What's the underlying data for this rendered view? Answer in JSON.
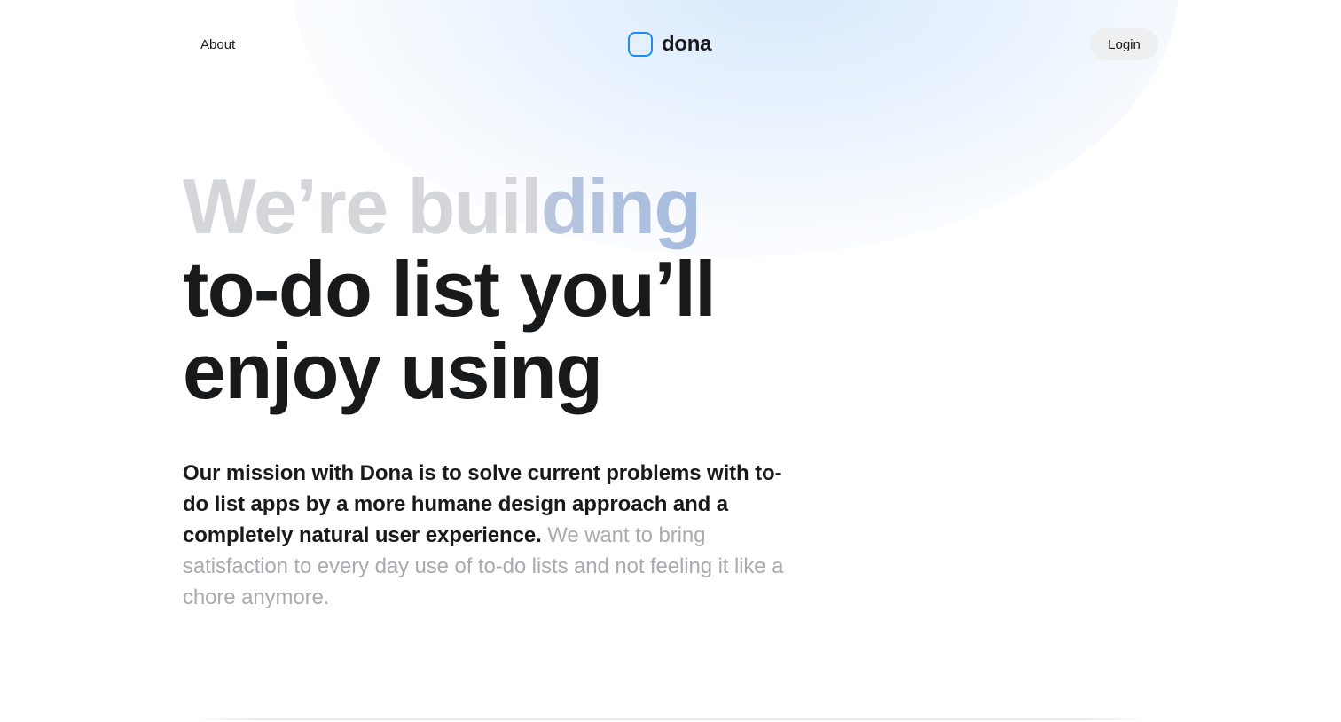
{
  "nav": {
    "about_label": "About",
    "brand_name": "dona",
    "brand_icon": "rounded-square-icon",
    "login_label": "Login"
  },
  "hero": {
    "line1_muted": "We’re buil",
    "line1_accent": "ding",
    "line2": "to-do list you’ll",
    "line3": "enjoy using"
  },
  "mission": {
    "strong_text": "Our mission with Dona is to solve current problems with to-do list apps by a more humane design approach and a completely natural user experience.",
    "soft_text": "We want to bring satisfaction to every day use of to-do lists and not feeling it like a chore anymore."
  },
  "colors": {
    "brand_accent": "#1e8cf0",
    "text_primary": "#18191b",
    "text_muted": "#a9abb1",
    "headline_faded": "#d4d6da",
    "headline_accent": "#a6bbe0",
    "button_bg": "#eeeff1"
  }
}
